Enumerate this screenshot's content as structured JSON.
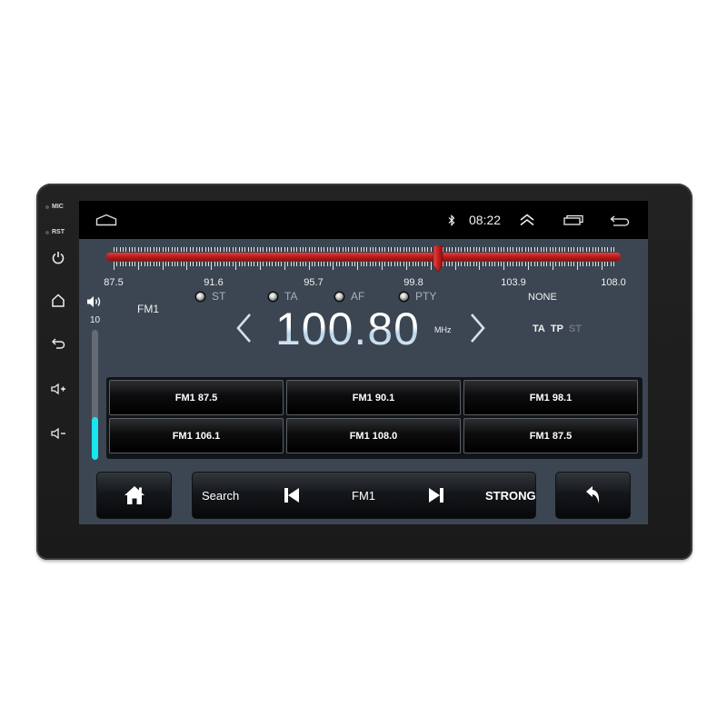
{
  "device": {
    "side_labels": {
      "mic": "MIC",
      "rst": "RST"
    },
    "side_buttons": [
      "power-icon",
      "home-icon",
      "back-icon",
      "volume-up-icon",
      "volume-down-icon"
    ]
  },
  "statusbar": {
    "home_icon": "home-outline-icon",
    "bluetooth_icon": "bluetooth-icon",
    "time": "08:22",
    "expand_icon": "double-chevron-up-icon",
    "recents_icon": "recent-apps-icon",
    "back_icon": "back-icon"
  },
  "tuner": {
    "scale_labels": [
      "87.5",
      "91.6",
      "95.7",
      "99.8",
      "103.9",
      "108.0"
    ],
    "range_mhz": [
      87.5,
      108.0
    ],
    "current_mhz": 100.8
  },
  "indicators": [
    {
      "label": "ST"
    },
    {
      "label": "TA"
    },
    {
      "label": "AF"
    },
    {
      "label": "PTY"
    }
  ],
  "pty_value": "NONE",
  "band": "FM1",
  "frequency": {
    "value": "100.80",
    "unit": "MHz"
  },
  "flags": [
    {
      "label": "TA",
      "active": true,
      "color": "#f0f0f0"
    },
    {
      "label": "TP",
      "active": true,
      "color": "#f0f0f0"
    },
    {
      "label": "ST",
      "active": false,
      "color": "#6e757c"
    }
  ],
  "volume": {
    "value": "10",
    "level_fraction": 0.33,
    "color": "#19e5ee"
  },
  "presets": [
    "FM1 87.5",
    "FM1 90.1",
    "FM1 98.1",
    "FM1 106.1",
    "FM1 108.0",
    "FM1 87.5"
  ],
  "controls": {
    "home_button": "home-icon",
    "search_label": "Search",
    "prev_icon": "skip-previous-icon",
    "band_label": "FM1",
    "next_icon": "skip-next-icon",
    "signal_label": "STRONG",
    "back_button": "return-icon"
  },
  "colors": {
    "screen_bg": "#3c4652",
    "tuner_red": "#c01a1a",
    "accent_cyan": "#19e5ee"
  }
}
